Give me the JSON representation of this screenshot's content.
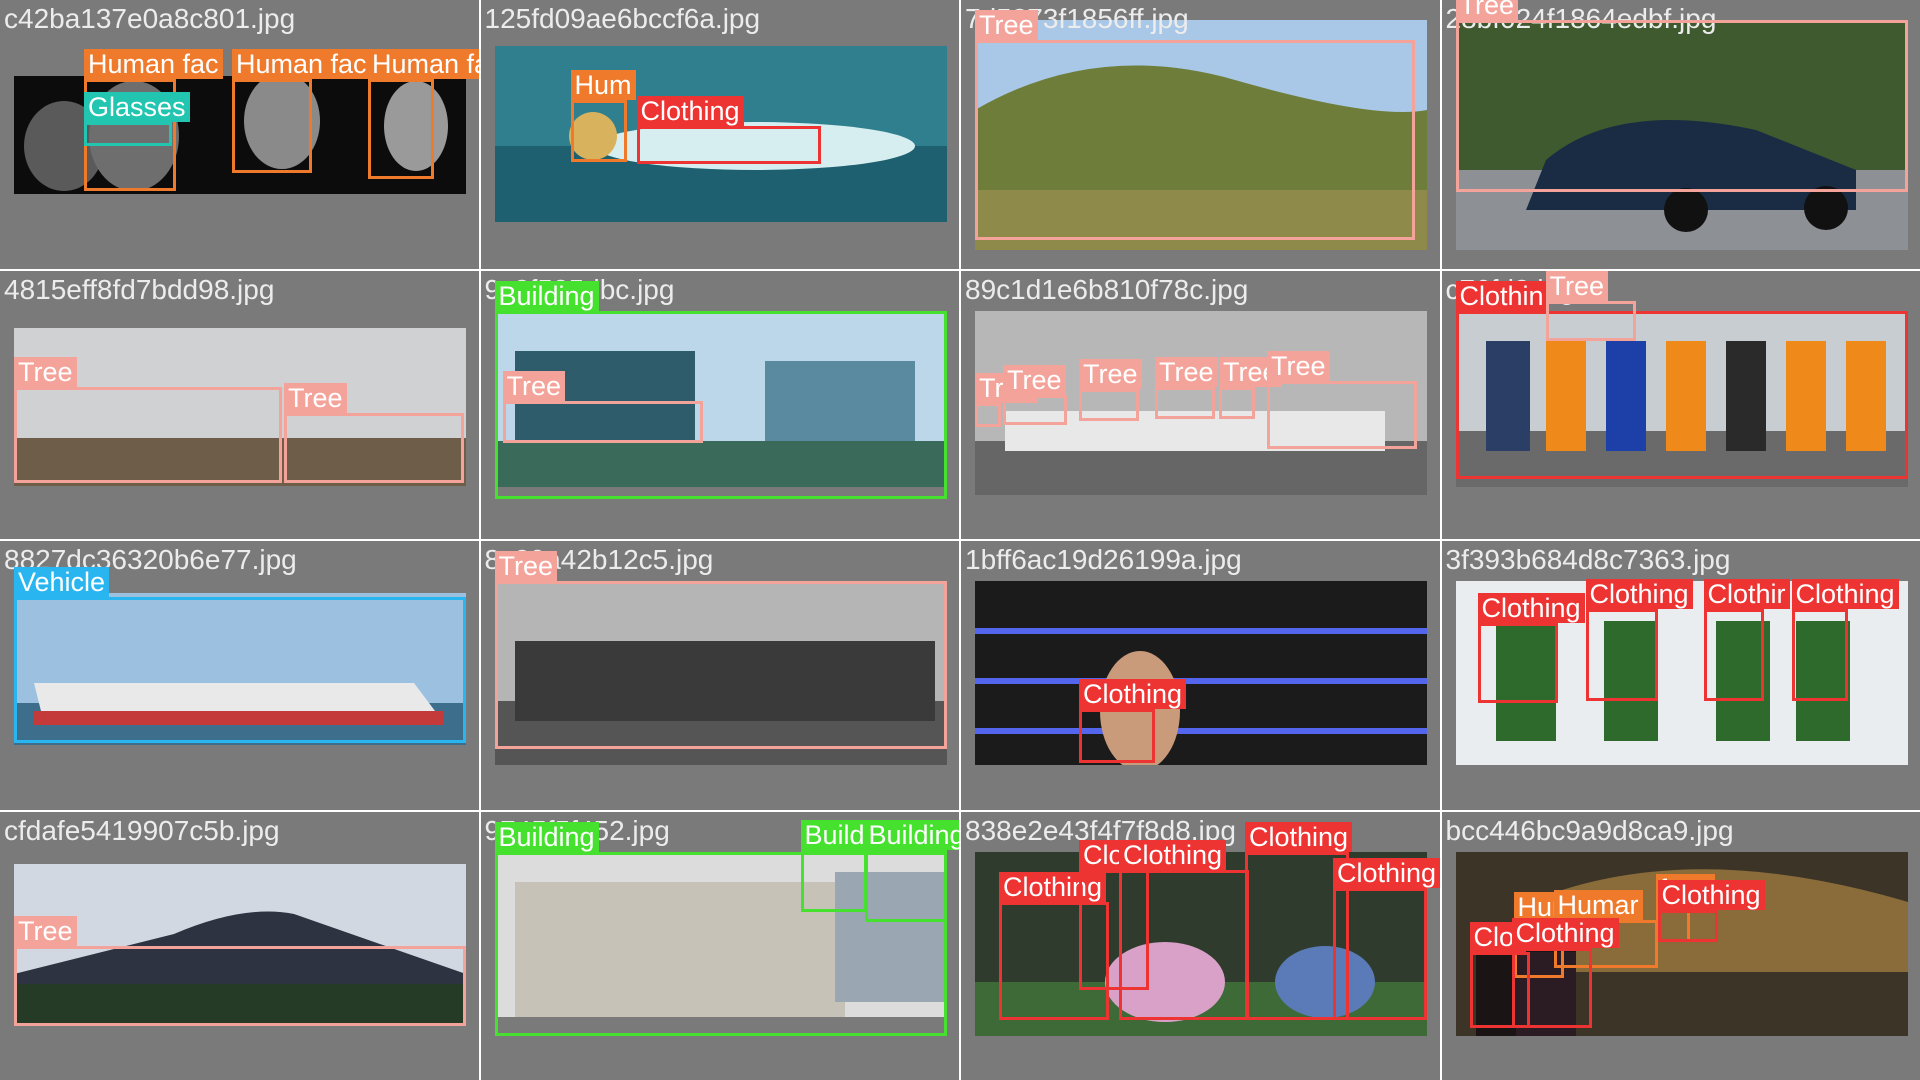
{
  "tiles": [
    {
      "filename": "c42ba137e0a8c801.jpg",
      "labels": [
        "Human fac",
        "Human fac",
        "Human face",
        "Glasses"
      ]
    },
    {
      "filename": "125fd09ae6bccf6a.jpg",
      "labels": [
        "Hum",
        "Clothing"
      ]
    },
    {
      "filename": "7d5373f1856ff.jpg",
      "labels": [
        "Tree"
      ]
    },
    {
      "filename": "28bf024f1864edbf.jpg",
      "labels": [
        "Tree"
      ]
    },
    {
      "filename": "4815eff8fd7bdd98.jpg",
      "labels": [
        "Tree",
        "Tree"
      ]
    },
    {
      "filename": "9c8f585dbc.jpg",
      "labels": [
        "Building",
        "Tree"
      ]
    },
    {
      "filename": "89c1d1e6b810f78c.jpg",
      "labels": [
        "Tree",
        "Tree",
        "Tree",
        "Tree",
        "Tree",
        "Tree"
      ]
    },
    {
      "filename": "c76fd8.jpg",
      "labels": [
        "Clothin",
        "Tree"
      ]
    },
    {
      "filename": "8827dc36320b6e77.jpg",
      "labels": [
        "Vehicle"
      ]
    },
    {
      "filename": "8c20a42b12c5.jpg",
      "labels": [
        "Tree"
      ]
    },
    {
      "filename": "1bff6ac19d26199a.jpg",
      "labels": [
        "Clothing"
      ]
    },
    {
      "filename": "3f393b684d8c7363.jpg",
      "labels": [
        "Clothing",
        "Clothing",
        "Clothir",
        "Clothing"
      ]
    },
    {
      "filename": "cfdafe5419907c5b.jpg",
      "labels": [
        "Tree"
      ]
    },
    {
      "filename": "9745f5f452.jpg",
      "labels": [
        "Building",
        "Build",
        "Building"
      ]
    },
    {
      "filename": "838e2e43f4f7f8d8.jpg",
      "labels": [
        "Clothing",
        "Clo",
        "Clothing",
        "Clothing",
        "Clothing"
      ]
    },
    {
      "filename": "bcc446bc9a9d8ca9.jpg",
      "labels": [
        "Clothing",
        "face",
        "Hun",
        "Humar",
        "Clot",
        "Clothing"
      ]
    }
  ],
  "colors": {
    "tree": "#f4a39a",
    "clothing": "#ee3333",
    "human_face": "#f07a2c",
    "glasses": "#22c5b0",
    "vehicle": "#29b6f0",
    "building": "#46e02e",
    "tile_background": "#7a7a7a"
  }
}
